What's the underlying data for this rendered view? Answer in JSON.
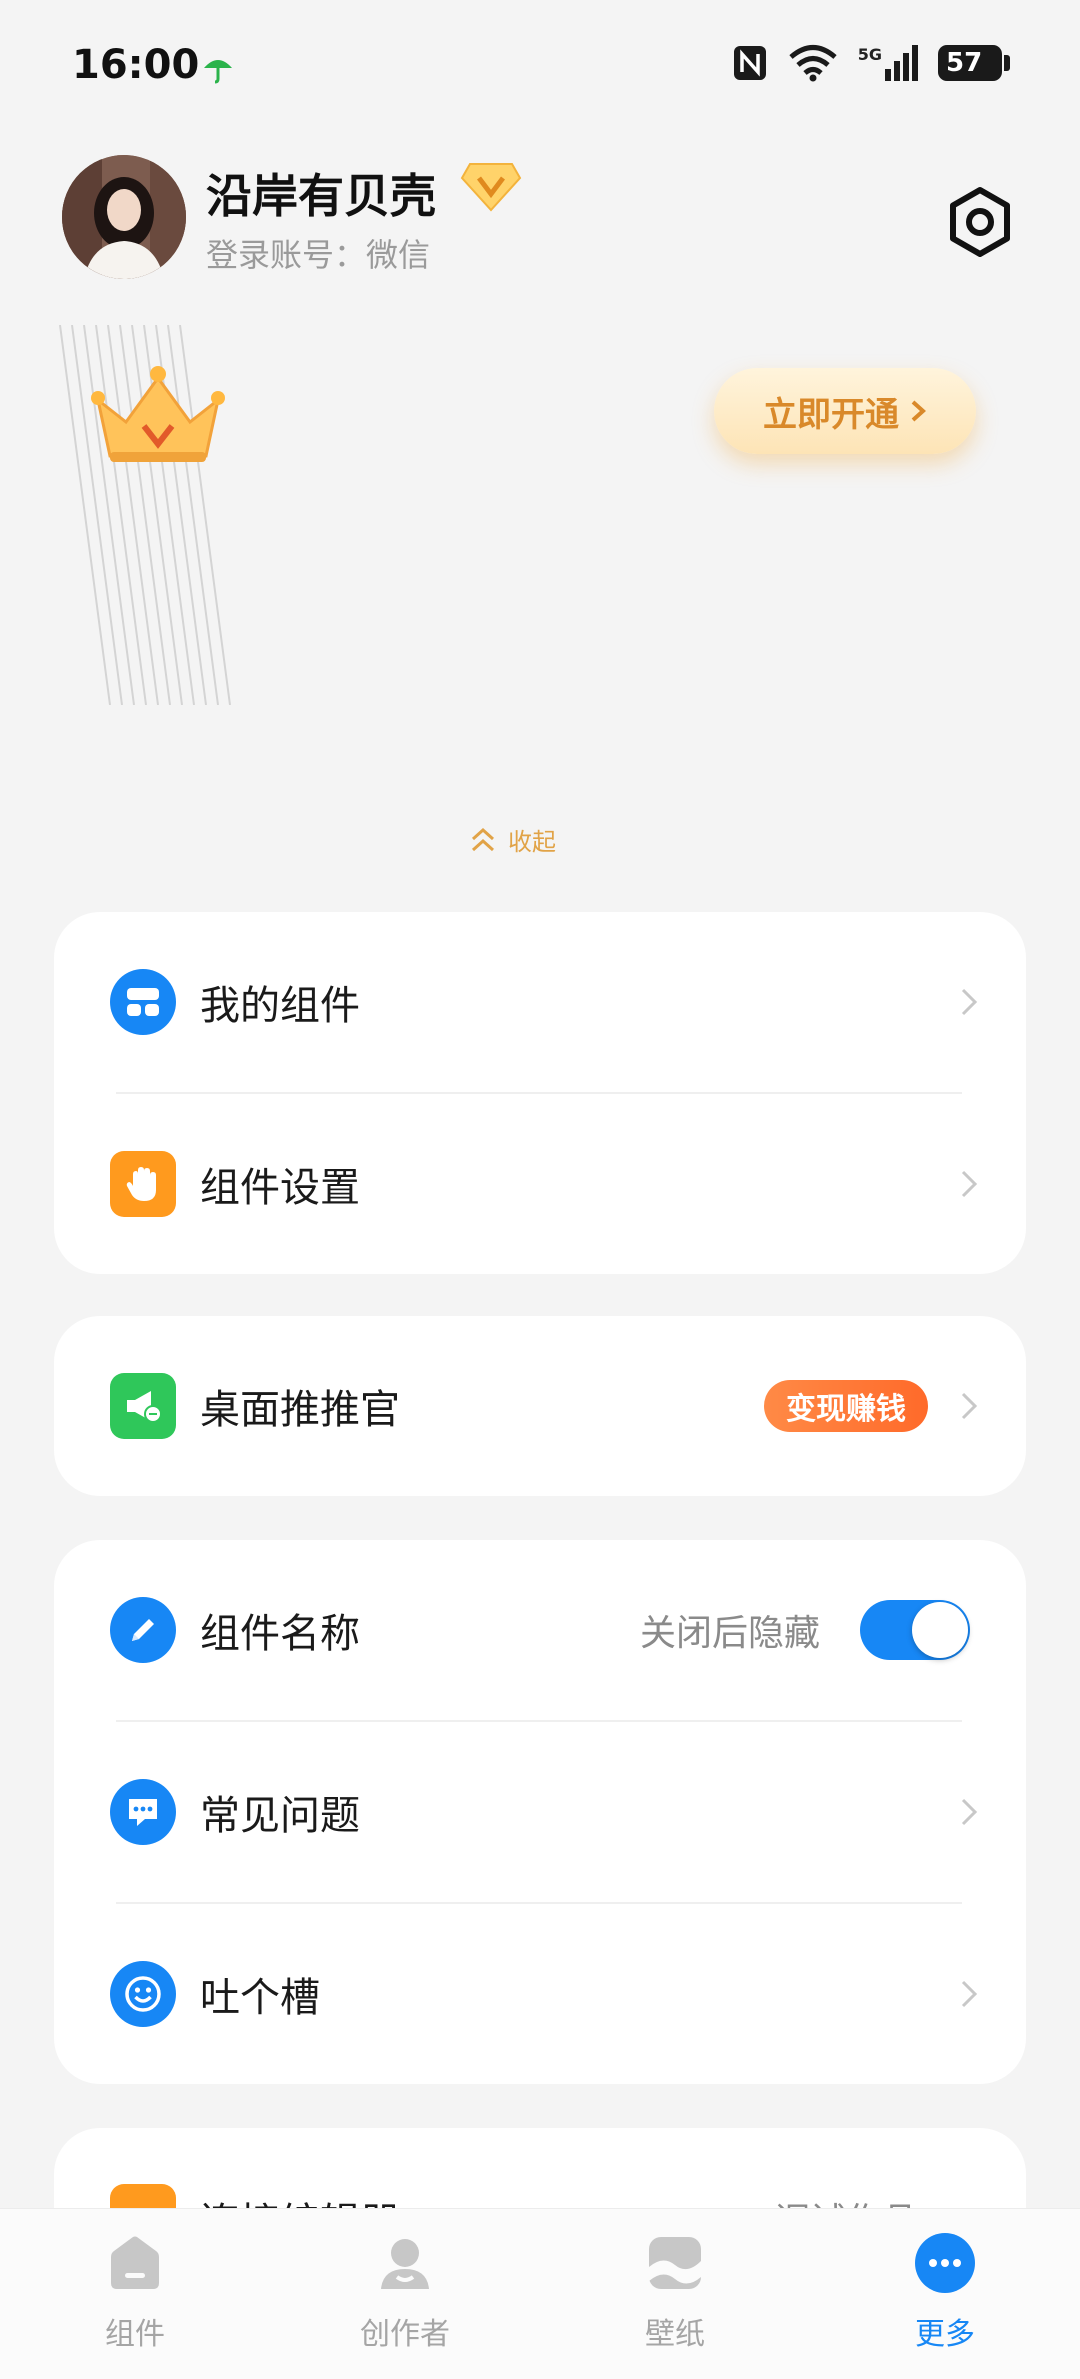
{
  "status_bar": {
    "time": "16:00",
    "battery": "57",
    "network": "5G"
  },
  "profile": {
    "username": "沿岸有贝壳",
    "login_label": "登录账号：微信"
  },
  "vip_banner": {
    "open_button": "立即开通",
    "collapse_label": "收起"
  },
  "menu": {
    "my_widgets": "我的组件",
    "widget_settings": "组件设置",
    "desktop_promoter": "桌面推推官",
    "monetize_badge": "变现赚钱",
    "widget_name": "组件名称",
    "widget_name_hint": "关闭后隐藏",
    "widget_name_toggle_on": true,
    "faq": "常见问题",
    "feedback": "吐个槽",
    "partial_row_label": "连接编辑器",
    "partial_row_hint": "调试作品"
  },
  "bottom_nav": {
    "items": [
      {
        "label": "组件"
      },
      {
        "label": "创作者"
      },
      {
        "label": "壁纸"
      },
      {
        "label": "更多"
      }
    ],
    "active_color": "#1787f5"
  },
  "colors": {
    "accent_blue": "#1787f5",
    "vip_gold": "#d9892a",
    "badge_orange": "#ff7a36"
  }
}
